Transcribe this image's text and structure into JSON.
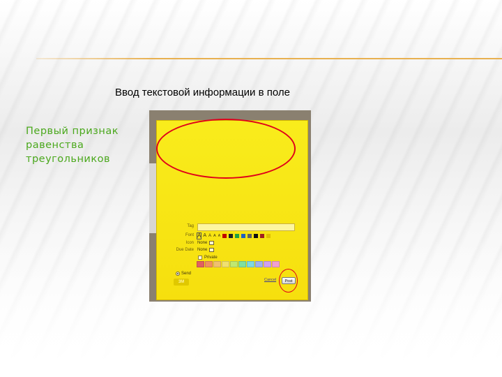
{
  "slide": {
    "caption": "Ввод текстовой информации в поле"
  },
  "note": {
    "text": "Первый признак\nравенства\nтреугольников",
    "text_color": "#4aa81c",
    "background_color": "#f8e81a"
  },
  "form": {
    "tag_label": "Tag",
    "font_label": "Font",
    "font_sizes": [
      "A",
      "A",
      "A",
      "A",
      "A"
    ],
    "icon_label": "Icon",
    "icon_value": "None",
    "due_label": "Due Date",
    "due_value": "None",
    "private_label": "Private",
    "send_label": "Send",
    "link_text": "Cancel",
    "post_button": "Post",
    "font_colors": [
      "#c00000",
      "#222222",
      "#20a040",
      "#2060c0",
      "#606060",
      "#101010",
      "#a02020",
      "#e0c000"
    ],
    "palette_colors": [
      "#e06060",
      "#f09060",
      "#f0c070",
      "#f0e070",
      "#c0e870",
      "#80e0a0",
      "#80d8e0",
      "#a0b0f0",
      "#d0a0f0",
      "#f0a0d0"
    ]
  },
  "highlight_color": "#e0001a"
}
